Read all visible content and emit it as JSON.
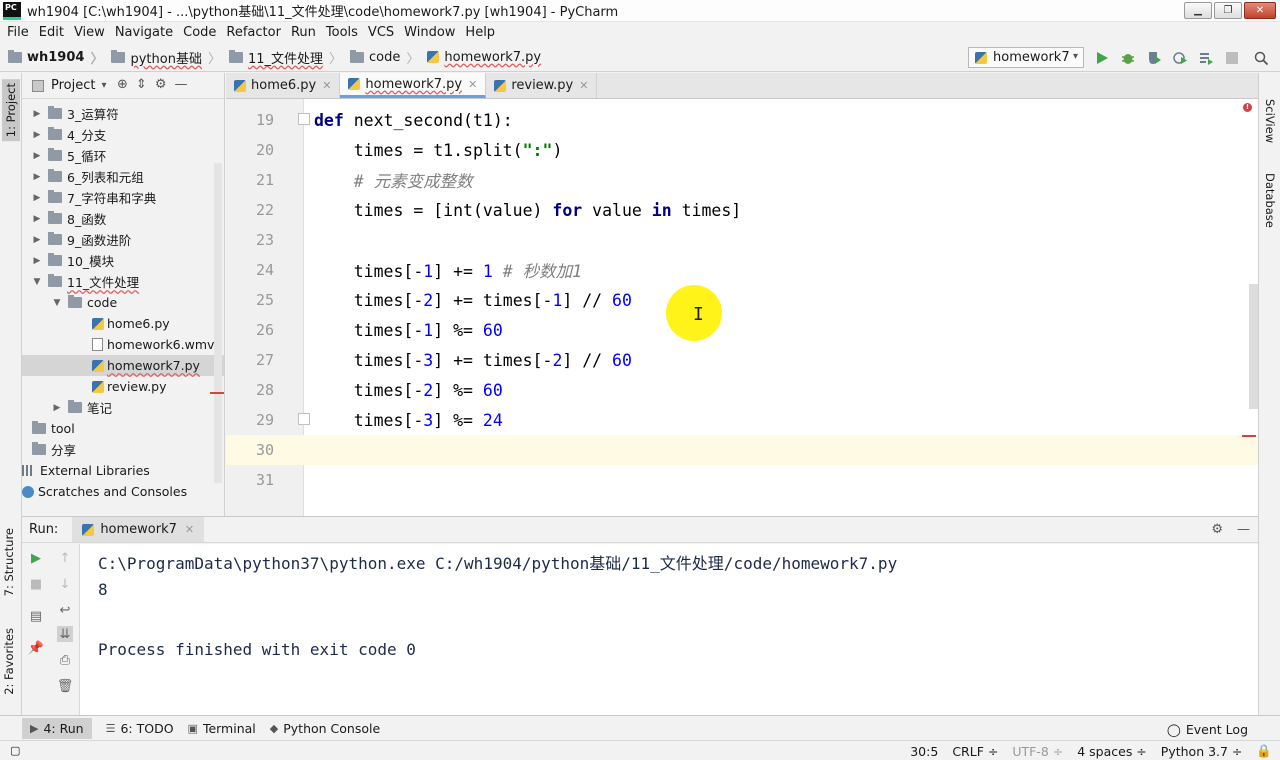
{
  "window": {
    "title": "wh1904 [C:\\wh1904] - ...\\python基础\\11_文件处理\\code\\homework7.py [wh1904] - PyCharm",
    "app_badge": "PC"
  },
  "menu": [
    "File",
    "Edit",
    "View",
    "Navigate",
    "Code",
    "Refactor",
    "Run",
    "Tools",
    "VCS",
    "Window",
    "Help"
  ],
  "breadcrumb": [
    "wh1904",
    "python基础",
    "11_文件处理",
    "code",
    "homework7.py"
  ],
  "run_config": "homework7",
  "side_left": {
    "project": "1: Project",
    "structure": "7: Structure",
    "favorites": "2: Favorites"
  },
  "side_right": {
    "sciview": "SciView",
    "database": "Database"
  },
  "project_panel": {
    "title": "Project",
    "tree": [
      {
        "label": "3_运算符",
        "indent": 0,
        "type": "folder",
        "expanded": false
      },
      {
        "label": "4_分支",
        "indent": 0,
        "type": "folder",
        "expanded": false
      },
      {
        "label": "5_循环",
        "indent": 0,
        "type": "folder",
        "expanded": false
      },
      {
        "label": "6_列表和元组",
        "indent": 0,
        "type": "folder",
        "expanded": false
      },
      {
        "label": "7_字符串和字典",
        "indent": 0,
        "type": "folder",
        "expanded": false
      },
      {
        "label": "8_函数",
        "indent": 0,
        "type": "folder",
        "expanded": false
      },
      {
        "label": "9_函数进阶",
        "indent": 0,
        "type": "folder",
        "expanded": false
      },
      {
        "label": "10_模块",
        "indent": 0,
        "type": "folder",
        "expanded": false
      },
      {
        "label": "11_文件处理",
        "indent": 0,
        "type": "folder",
        "expanded": true
      },
      {
        "label": "code",
        "indent": 1,
        "type": "folder",
        "expanded": true
      },
      {
        "label": "home6.py",
        "indent": 2,
        "type": "py"
      },
      {
        "label": "homework6.wmv",
        "indent": 2,
        "type": "file"
      },
      {
        "label": "homework7.py",
        "indent": 2,
        "type": "py",
        "selected": true
      },
      {
        "label": "review.py",
        "indent": 2,
        "type": "py"
      },
      {
        "label": "笔记",
        "indent": 1,
        "type": "folder",
        "expanded": false
      },
      {
        "label": "tool",
        "indent": -1,
        "type": "folder"
      },
      {
        "label": "分享",
        "indent": -1,
        "type": "folder"
      },
      {
        "label": "External Libraries",
        "indent": -2,
        "type": "lib"
      },
      {
        "label": "Scratches and Consoles",
        "indent": -2,
        "type": "console"
      }
    ]
  },
  "editor_tabs": [
    {
      "label": "home6.py",
      "active": false
    },
    {
      "label": "homework7.py",
      "active": true
    },
    {
      "label": "review.py",
      "active": false
    }
  ],
  "code_lines": [
    {
      "n": "19",
      "text": "def next_second(t1):"
    },
    {
      "n": "20",
      "text": "    times = t1.split(\":\")"
    },
    {
      "n": "21",
      "text": "    # 元素变成整数"
    },
    {
      "n": "22",
      "text": "    times = [int(value) for value in times]"
    },
    {
      "n": "23",
      "text": ""
    },
    {
      "n": "24",
      "text": "    times[-1] += 1 # 秒数加1"
    },
    {
      "n": "25",
      "text": "    times[-2] += times[-1] // 60"
    },
    {
      "n": "26",
      "text": "    times[-1] %= 60"
    },
    {
      "n": "27",
      "text": "    times[-3] += times[-2] // 60"
    },
    {
      "n": "28",
      "text": "    times[-2] %= 60"
    },
    {
      "n": "29",
      "text": "    times[-3] %= 24"
    },
    {
      "n": "30",
      "text": ""
    },
    {
      "n": "31",
      "text": ""
    }
  ],
  "run_panel": {
    "label": "Run:",
    "tab": "homework7",
    "output": [
      "C:\\ProgramData\\python37\\python.exe C:/wh1904/python基础/11_文件处理/code/homework7.py",
      "8",
      "",
      "Process finished with exit code 0"
    ]
  },
  "bottom_tabs": [
    "4: Run",
    "6: TODO",
    "Terminal",
    "Python Console"
  ],
  "event_log": "Event Log",
  "status": {
    "position": "30:5",
    "line_sep": "CRLF ÷",
    "encoding": "UTF-8 ÷",
    "indent": "4 spaces ÷",
    "interpreter": "Python 3.7 ÷"
  }
}
